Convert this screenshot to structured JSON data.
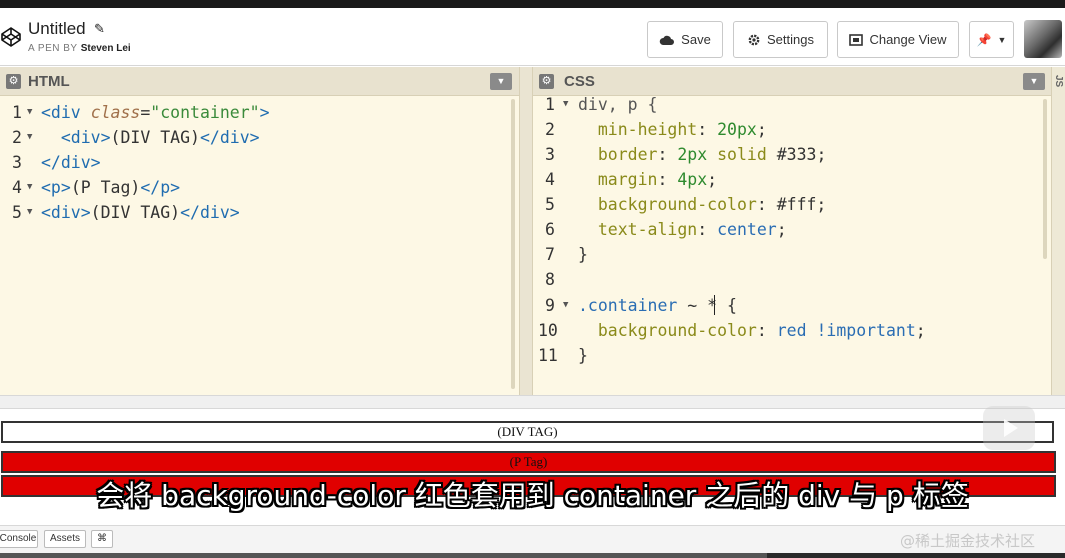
{
  "header": {
    "title": "Untitled",
    "byline_prefix": "A PEN BY",
    "author": "Steven Lei",
    "buttons": {
      "save": "Save",
      "settings": "Settings",
      "change_view": "Change View"
    }
  },
  "html_panel": {
    "label": "HTML",
    "line_numbers": [
      "1",
      "2",
      "3",
      "4",
      "5"
    ]
  },
  "css_panel": {
    "label": "CSS",
    "line_numbers": [
      "1",
      "2",
      "3",
      "4",
      "5",
      "6",
      "7",
      "8",
      "9",
      "10",
      "11"
    ]
  },
  "side_tab": "JS",
  "preview": {
    "div_tag": "(DIV TAG)",
    "p_tag": "(P Tag)"
  },
  "subtitle": "会将 background-color 红色套用到 container 之后的 div 与 p 标签",
  "footer": {
    "console": "Console",
    "assets": "Assets",
    "shortcuts": "⌘"
  },
  "watermark": "@稀土掘金技术社区",
  "colors": {
    "editor_bg": "#fdf8e5",
    "preview_red": "#e00000"
  },
  "video_progress": 0.72
}
